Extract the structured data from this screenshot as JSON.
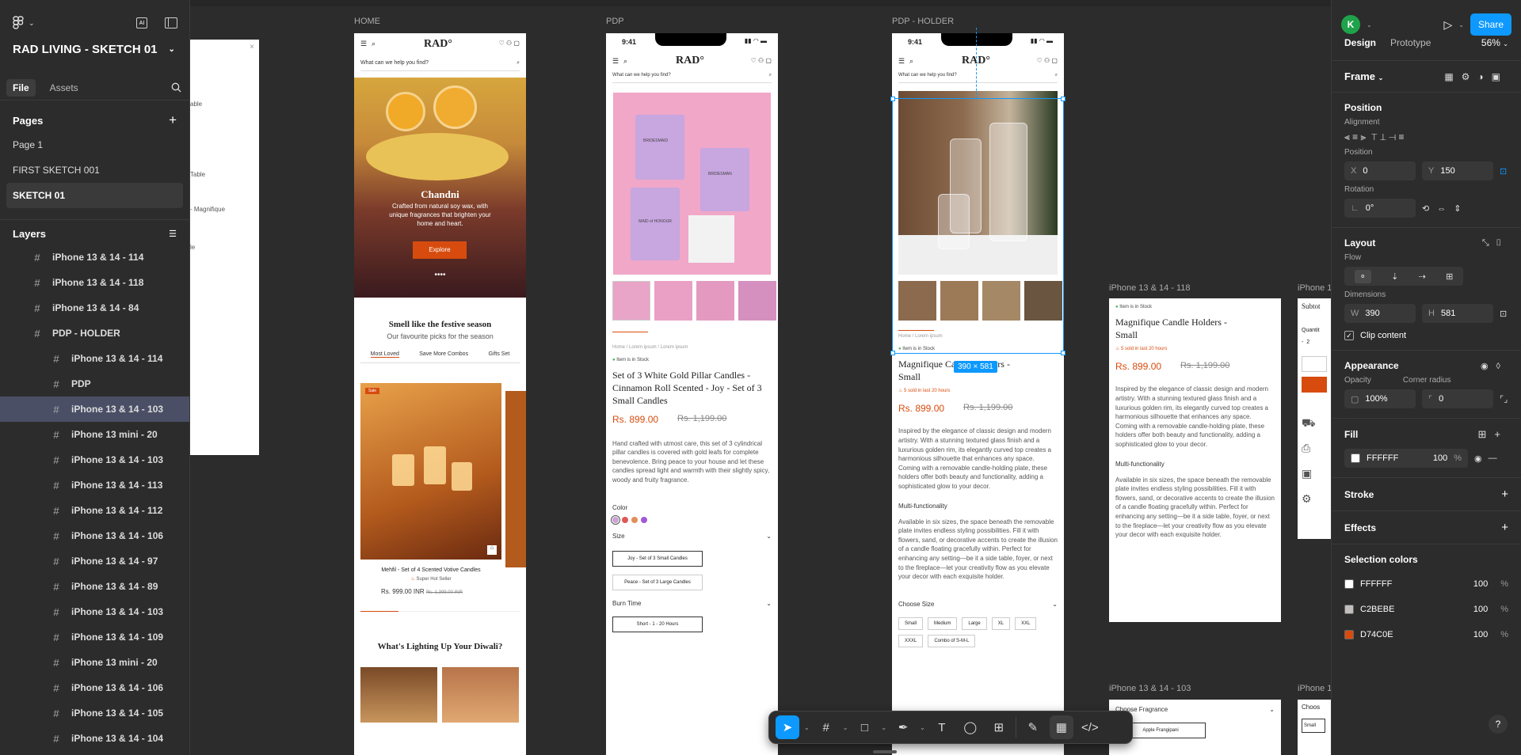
{
  "left": {
    "file_title": "RAD LIVING - SKETCH 01",
    "tabs": [
      "File",
      "Assets"
    ],
    "pages_label": "Pages",
    "pages": [
      "Page 1",
      "FIRST SKETCH 001",
      "SKETCH 01"
    ],
    "layers_label": "Layers",
    "layers": [
      {
        "name": "iPhone 13 & 14 - 114",
        "indent": 0
      },
      {
        "name": "iPhone 13 & 14 - 118",
        "indent": 0
      },
      {
        "name": "iPhone 13 & 14 - 84",
        "indent": 0
      },
      {
        "name": "PDP - HOLDER",
        "indent": 0
      },
      {
        "name": "iPhone 13 & 14 - 114",
        "indent": 1
      },
      {
        "name": "PDP",
        "indent": 1
      },
      {
        "name": "iPhone 13 & 14 - 103",
        "indent": 1,
        "selected": true
      },
      {
        "name": "iPhone 13 mini - 20",
        "indent": 1
      },
      {
        "name": "iPhone 13 & 14 - 103",
        "indent": 1
      },
      {
        "name": "iPhone 13 & 14 - 113",
        "indent": 1
      },
      {
        "name": "iPhone 13 & 14 - 112",
        "indent": 1
      },
      {
        "name": "iPhone 13 & 14 - 106",
        "indent": 1
      },
      {
        "name": "iPhone 13 & 14 - 97",
        "indent": 1
      },
      {
        "name": "iPhone 13 & 14 - 89",
        "indent": 1
      },
      {
        "name": "iPhone 13 & 14 - 103",
        "indent": 1
      },
      {
        "name": "iPhone 13 & 14 - 109",
        "indent": 1
      },
      {
        "name": "iPhone 13 mini - 20",
        "indent": 1
      },
      {
        "name": "iPhone 13 & 14 - 106",
        "indent": 1
      },
      {
        "name": "iPhone 13 & 14 - 105",
        "indent": 1
      },
      {
        "name": "iPhone 13 & 14 - 104",
        "indent": 1
      }
    ]
  },
  "canvas": {
    "partial_texts": [
      "able",
      "Table",
      "- Magnifique",
      "le"
    ],
    "home": {
      "label": "HOME",
      "logo": "RAD°",
      "search": "What can we help you find?",
      "hero_title": "Chandni",
      "hero_text": "Crafted from natural soy wax, with unique fragrances that brighten your home and heart.",
      "hero_button": "Explore",
      "section_title": "Smell like the festive season",
      "section_sub": "Our favourite picks for the season",
      "section_tabs": [
        "Most Loved",
        "Save More Combos",
        "Gifts Set"
      ],
      "product_name": "Mehfil - Set of 4 Scented Votive Candles",
      "product_badge": "Super Hot Seller",
      "product_price": "Rs. 999.00 INR",
      "product_old": "Rs. 1,399.00 INR",
      "product_tag": "Sale",
      "next_title": "What's Lighting Up Your Diwali?"
    },
    "pdp": {
      "label": "PDP",
      "time": "9:41",
      "logo": "RAD°",
      "search": "What can we help you find?",
      "breadcrumb": "Home / Lorem ipsum / Lorem ipsum",
      "stock": "Item is in Stock",
      "title": "Set of 3 White Gold Pillar Candles - Cinnamon Roll Scented - Joy - Set of 3 Small Candles",
      "price": "Rs. 899.00",
      "old_price": "Rs. 1,199.00",
      "desc": "Hand crafted with utmost care, this set of 3 cylindrical pillar candles is covered with gold leafs for complete benevolence. Bring peace to your house and let these candles spread light and warmth with their slightly spicy, woody and fruity fragrance.",
      "color_label": "Color",
      "size_label": "Size",
      "sizes": [
        "Joy - Set of 3 Small Candles",
        "Peace - Set of 3 Large Candles"
      ],
      "burn_label": "Burn Time",
      "burn": "Short - 1 - 20 Hours",
      "jar_texts": [
        "BRIDESMAID",
        "BRIDESMAN",
        "MAID of HONOUR"
      ]
    },
    "holder": {
      "label": "PDP - HOLDER",
      "time": "9:41",
      "logo": "RAD°",
      "search": "What can we help you find?",
      "dim_badge": "390 × 581",
      "breadcrumb": "Home / Lorem ipsum",
      "stock": "Item is in Stock",
      "title": "Magnifique Candle Holders - Small",
      "sold": "5 sold in last 20 hours",
      "price": "Rs. 899.00",
      "old_price": "Rs. 1,199.00",
      "desc": "Inspired by the elegance of classic design and modern artistry. With a stunning textured glass finish and a luxurious golden rim, its elegantly curved top creates a harmonious silhouette that enhances any space. Coming with a removable candle-holding plate, these holders offer both beauty and functionality, adding a sophisticated glow to your decor.",
      "multi_title": "Multi-functionality",
      "multi_text": "Available in six sizes, the space beneath the removable plate invites endless styling possibilities. Fill it with flowers, sand, or decorative accents to create the illusion of a candle floating gracefully within. Perfect for enhancing any setting—be it a side table, foyer, or next to the fireplace—let your creativity flow as you elevate your decor with each exquisite holder.",
      "size_label": "Choose Size",
      "sizes": [
        "Small",
        "Medium",
        "Large",
        "XL",
        "XXL",
        "XXXL",
        "Combo of S-M-L"
      ]
    },
    "f118": {
      "label": "iPhone 13 & 14 - 118",
      "stock": "Item is in Stock",
      "title": "Magnifique Candle Holders - Small",
      "sold": "5 sold in last 20 hours",
      "price": "Rs. 899.00",
      "old_price": "Rs. 1,199.00",
      "desc": "Inspired by the elegance of classic design and modern artistry. With a stunning textured glass finish and a luxurious golden rim, its elegantly curved top creates a harmonious silhouette that enhances any space. Coming with a removable candle-holding plate, these holders offer both beauty and functionality, adding a sophisticated glow to your decor.",
      "multi_title": "Multi-functionality",
      "multi_text": "Available in six sizes, the space beneath the removable plate invites endless styling possibilities. Fill it with flowers, sand, or decorative accents to create the illusion of a candle floating gracefully within. Perfect for enhancing any setting—be it a side table, foyer, or next to the fireplace—let your creativity flow as you elevate your decor with each exquisite holder."
    },
    "f103": {
      "label": "iPhone 13 & 14 - 103",
      "fragrance_label": "Choose Fragrance",
      "fragrance": "Apple Frangipani"
    },
    "right_partial": {
      "label": "iPhone 1",
      "subtotal": "Subtot",
      "qty": "Quantit",
      "qty_val": "2",
      "choose": "Choos",
      "small": "Small"
    }
  },
  "right": {
    "avatar": "K",
    "share": "Share",
    "tabs": [
      "Design",
      "Prototype"
    ],
    "zoom": "56%",
    "frame_label": "Frame",
    "position_label": "Position",
    "alignment_label": "Alignment",
    "position_sub": "Position",
    "x_label": "X",
    "x": "0",
    "y_label": "Y",
    "y": "150",
    "rotation_label": "Rotation",
    "rotation": "0°",
    "layout_label": "Layout",
    "flow_label": "Flow",
    "dimensions_label": "Dimensions",
    "w_label": "W",
    "w": "390",
    "h_label": "H",
    "h": "581",
    "clip": "Clip content",
    "appearance_label": "Appearance",
    "opacity_label": "Opacity",
    "opacity": "100%",
    "radius_label": "Corner radius",
    "radius": "0",
    "fill_label": "Fill",
    "fill_hex": "FFFFFF",
    "fill_opacity": "100",
    "pct": "%",
    "stroke_label": "Stroke",
    "effects_label": "Effects",
    "selcolors_label": "Selection colors",
    "selcolors": [
      {
        "hex": "FFFFFF",
        "opacity": "100",
        "color": "#FFFFFF"
      },
      {
        "hex": "C2BEBE",
        "opacity": "100",
        "color": "#C2BEBE"
      },
      {
        "hex": "D74C0E",
        "opacity": "100",
        "color": "#D74C0E"
      }
    ],
    "help": "?"
  },
  "colors": {
    "accent": "#0d99ff",
    "brand_orange": "#d74c0e",
    "swatches": [
      "#c9a3d6",
      "#e05858",
      "#e0905a",
      "#a05ad6"
    ]
  }
}
